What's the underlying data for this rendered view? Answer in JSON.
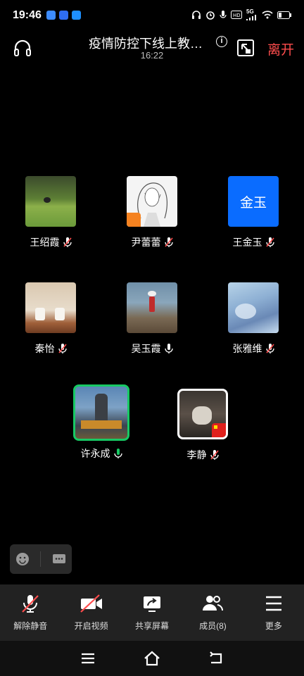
{
  "status": {
    "time": "19:46",
    "network": "5G",
    "battery": "low"
  },
  "header": {
    "title": "疫情防控下线上教…",
    "timer": "16:22",
    "leave_label": "离开"
  },
  "participants": [
    {
      "name": "王绍霞",
      "avatar": "photo-grass",
      "muted": true
    },
    {
      "name": "尹蕾蕾",
      "avatar": "photo-illustration",
      "muted": true
    },
    {
      "name": "王金玉",
      "avatar_text": "金玉",
      "muted": true
    },
    {
      "name": "秦怡",
      "avatar": "photo-cups",
      "muted": true
    },
    {
      "name": "吴玉霞",
      "avatar": "photo-beach",
      "muted": false
    },
    {
      "name": "张雅维",
      "avatar": "photo-fantasy",
      "muted": true
    },
    {
      "name": "许永成",
      "avatar": "photo-statue",
      "muted": false,
      "speaking": true
    },
    {
      "name": "李静",
      "avatar": "photo-cat",
      "muted": true
    }
  ],
  "toolbar": {
    "unmute": "解除静音",
    "video": "开启视频",
    "share": "共享屏幕",
    "members": "成员(8)",
    "more": "更多"
  },
  "colors": {
    "accent_leave": "#ff4d4d",
    "speaking_border": "#17c964",
    "avatar_blue": "#0a6cff"
  }
}
